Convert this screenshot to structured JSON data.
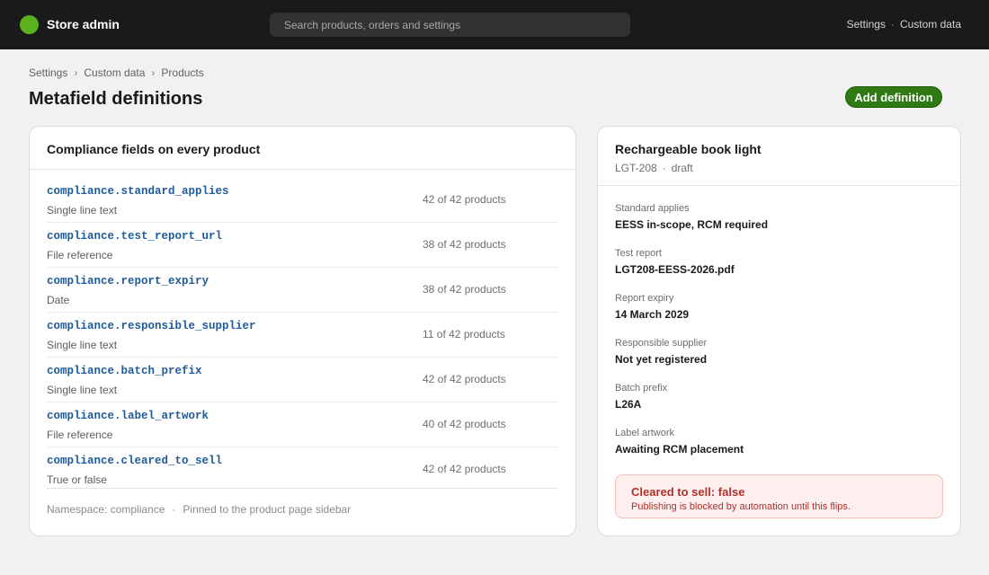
{
  "app": {
    "title": "Store admin"
  },
  "search": {
    "placeholder": "Search products, orders and settings"
  },
  "top_nav": {
    "items": [
      "Settings",
      "Custom data"
    ],
    "separator": "·"
  },
  "breadcrumb": {
    "items": [
      "Settings",
      "Custom data",
      "Products"
    ],
    "separator": "›"
  },
  "page": {
    "title": "Metafield definitions",
    "add_button_label": "Add definition"
  },
  "fields_card": {
    "heading": "Compliance fields on every product",
    "rows": [
      {
        "key": "compliance.standard_applies",
        "type": "Single line text",
        "count": "42 of 42 products"
      },
      {
        "key": "compliance.test_report_url",
        "type": "File reference",
        "count": "38 of 42 products"
      },
      {
        "key": "compliance.report_expiry",
        "type": "Date",
        "count": "38 of 42 products"
      },
      {
        "key": "compliance.responsible_supplier",
        "type": "Single line text",
        "count": "11 of 42 products"
      },
      {
        "key": "compliance.batch_prefix",
        "type": "Single line text",
        "count": "42 of 42 products"
      },
      {
        "key": "compliance.label_artwork",
        "type": "File reference",
        "count": "40 of 42 products"
      },
      {
        "key": "compliance.cleared_to_sell",
        "type": "True or false",
        "count": "42 of 42 products"
      }
    ],
    "footer": {
      "namespace": "Namespace: compliance",
      "separator": "·",
      "pinned": "Pinned to the product page sidebar"
    }
  },
  "product_card": {
    "name": "Rechargeable book light",
    "sku": "LGT-208",
    "separator": "·",
    "status": "draft",
    "details": [
      {
        "label": "Standard applies",
        "value": "EESS in-scope, RCM required"
      },
      {
        "label": "Test report",
        "value": "LGT208-EESS-2026.pdf"
      },
      {
        "label": "Report expiry",
        "value": "14 March 2029"
      },
      {
        "label": "Responsible supplier",
        "value": "Not yet registered"
      },
      {
        "label": "Batch prefix",
        "value": "L26A"
      },
      {
        "label": "Label artwork",
        "value": "Awaiting RCM placement"
      }
    ],
    "alert": {
      "title": "Cleared to sell: false",
      "text": "Publishing is blocked by automation until this flips."
    }
  },
  "colors": {
    "topbar": "#1a1a1a",
    "brand_logo": "#5ab11d",
    "primary_button": "#2f7a14",
    "field_key": "#1f5b9a",
    "alert_text": "#b0312b",
    "alert_bg": "#fcefee"
  },
  "icons": {
    "logo": "store-logo-icon"
  }
}
